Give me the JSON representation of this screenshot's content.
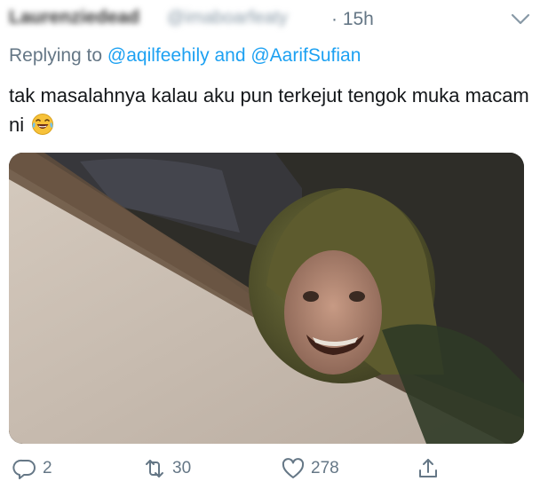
{
  "tweet": {
    "author_name_obscured": "Laurenziedead",
    "author_handle_obscured": "@imaboarfeaty",
    "timestamp": "· 15h",
    "replying_to": {
      "prefix": "Replying to",
      "mention1": "@aqilfeehily",
      "conjunction": "and",
      "mention2": "@AarifSufian"
    },
    "text": "tak masalahnya kalau aku pun terkejut tengok muka macam ni",
    "emoji_icon": "face-with-tears-of-joy-icon"
  },
  "actions": {
    "replies": "2",
    "retweets": "30",
    "likes": "278"
  },
  "colors": {
    "link": "#1da1f2",
    "muted": "#657786",
    "text": "#14171a"
  }
}
